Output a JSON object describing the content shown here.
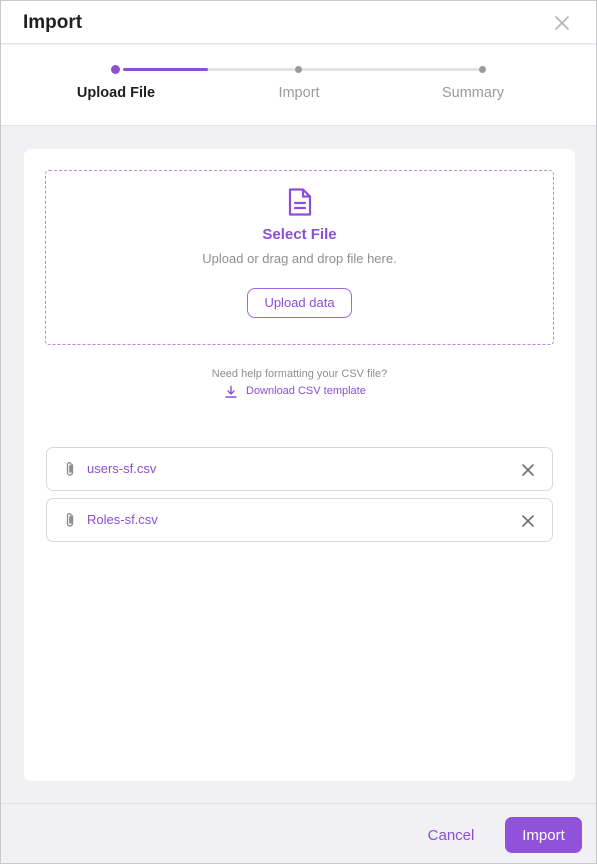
{
  "dialog": {
    "title": "Import"
  },
  "stepper": {
    "steps": [
      {
        "label": "Upload File",
        "state": "active"
      },
      {
        "label": "Import",
        "state": "pending"
      },
      {
        "label": "Summary",
        "state": "pending"
      }
    ]
  },
  "dropzone": {
    "icon": "file-text-icon",
    "title": "Select File",
    "subtitle": "Upload or drag and drop file here.",
    "button_label": "Upload data"
  },
  "template_help": {
    "text": "Need help formatting your CSV file?",
    "link_icon": "download-icon",
    "link_label": "Download CSV template"
  },
  "files": [
    {
      "icon": "paperclip-icon",
      "name": "users-sf.csv"
    },
    {
      "icon": "paperclip-icon",
      "name": "Roles-sf.csv"
    }
  ],
  "footer": {
    "cancel_label": "Cancel",
    "import_label": "Import"
  },
  "colors": {
    "accent": "#8a4fd6",
    "accent_fill": "#8f52d8",
    "muted": "#8e8e93"
  }
}
